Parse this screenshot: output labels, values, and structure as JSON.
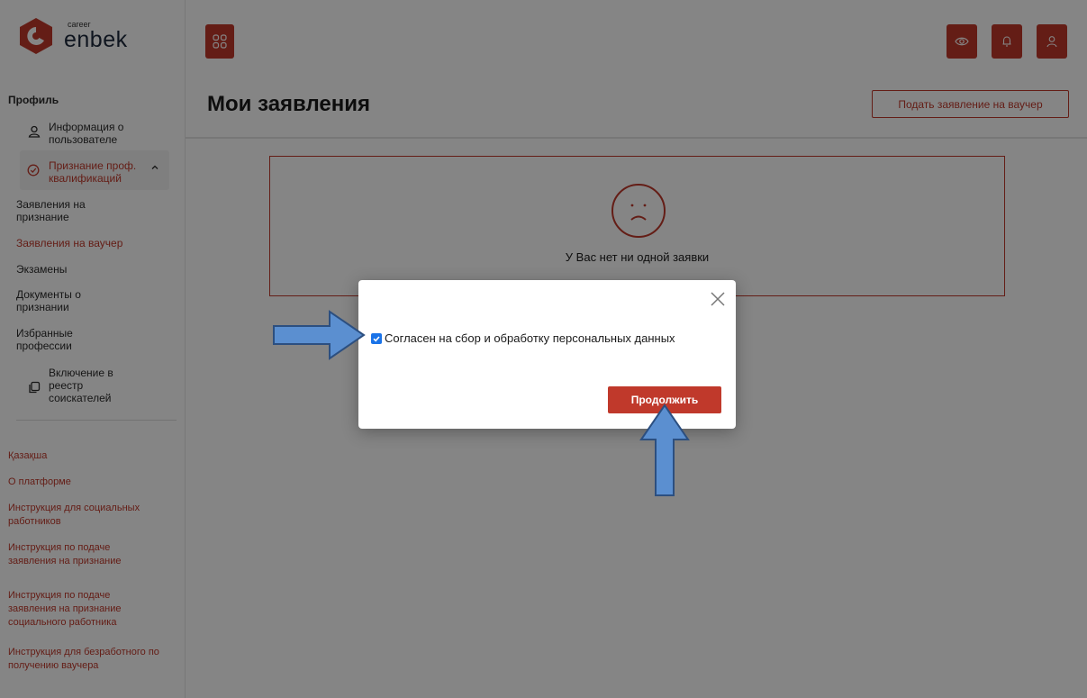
{
  "brand": {
    "small": "career",
    "big": "enbek"
  },
  "sidebar": {
    "profile_title": "Профиль",
    "user_info": "Информация о пользователе",
    "recognition": "Признание проф. квалификаций",
    "sub_items": [
      "Заявления на признание",
      "Заявления на ваучер",
      "Экзамены",
      "Документы о признании",
      "Избранные профессии"
    ],
    "registry": "Включение в реестр соискателей",
    "links": [
      "Қазақша",
      "О платформе",
      "Инструкция для социальных работников",
      "Инструкция по подаче заявления на признание",
      "Инструкция по подаче заявления на признание социального работника",
      "Инструкция для безработного по получению ваучера"
    ]
  },
  "main": {
    "title": "Мои заявления",
    "apply_button": "Подать заявление на ваучер",
    "empty_text": "У Вас нет ни одной заявки"
  },
  "modal": {
    "consent_label": "Согласен на сбор и обработку персональных данных",
    "consent_checked": true,
    "continue_button": "Продолжить"
  },
  "colors": {
    "accent": "#c0392b",
    "checkbox": "#1a73e8",
    "arrow_fill": "#5b8fd0",
    "arrow_stroke": "#2c4f80"
  },
  "icons": {
    "grid": "grid-icon",
    "eye": "eye-icon",
    "bell": "bell-icon",
    "user": "user-icon",
    "close": "close-icon",
    "sad": "sad-face-icon"
  }
}
